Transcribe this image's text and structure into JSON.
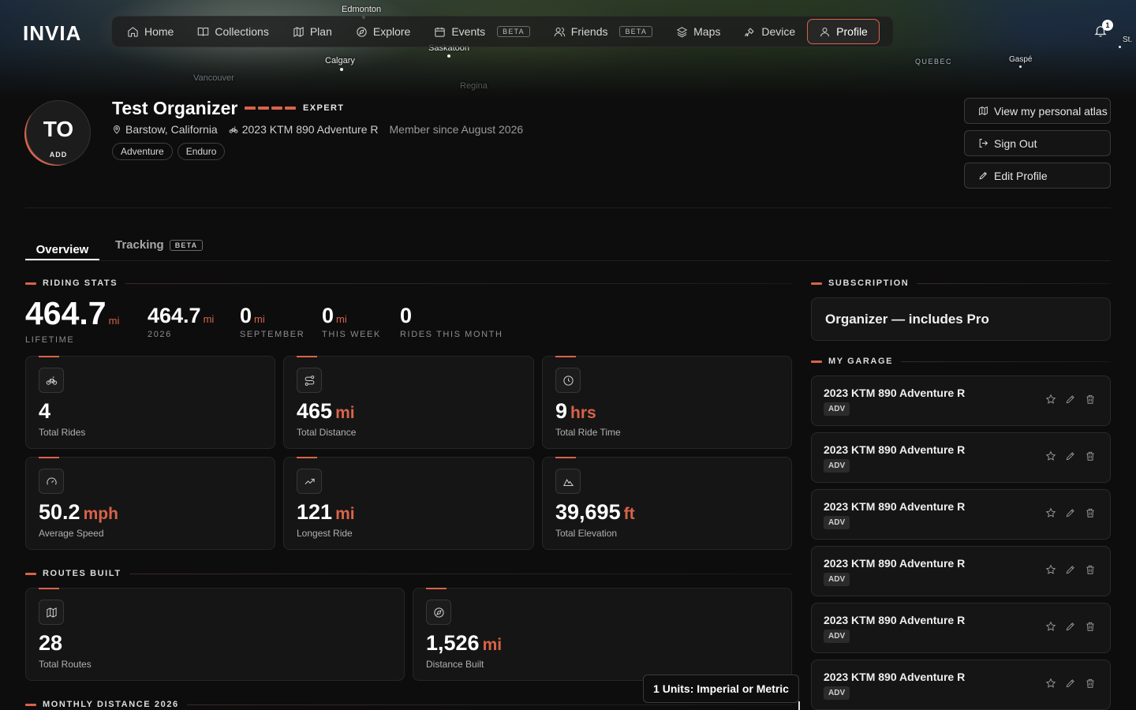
{
  "app": {
    "logo": "INVIA"
  },
  "map_labels": [
    "Edmonton",
    "Saskatoon",
    "Calgary",
    "Vancouver",
    "Regina",
    "QUEBEC",
    "Gaspé",
    "St."
  ],
  "nav": {
    "items": [
      {
        "label": "Home",
        "icon": "home-icon"
      },
      {
        "label": "Collections",
        "icon": "book-icon"
      },
      {
        "label": "Plan",
        "icon": "map-icon"
      },
      {
        "label": "Explore",
        "icon": "compass-icon"
      },
      {
        "label": "Events",
        "icon": "calendar-icon",
        "badge": "BETA"
      },
      {
        "label": "Friends",
        "icon": "users-icon",
        "badge": "BETA"
      },
      {
        "label": "Maps",
        "icon": "layers-icon"
      },
      {
        "label": "Device",
        "icon": "satellite-icon"
      },
      {
        "label": "Profile",
        "icon": "user-icon",
        "active": true
      }
    ],
    "notifications_count": "1"
  },
  "profile": {
    "initials": "TO",
    "avatar_add": "ADD",
    "name": "Test Organizer",
    "level": "EXPERT",
    "location": "Barstow, California",
    "bike": "2023 KTM 890 Adventure R",
    "member_since": "Member since August 2026",
    "tags": [
      "Adventure",
      "Enduro"
    ]
  },
  "actions": {
    "atlas": "View my personal atlas",
    "sign_out": "Sign Out",
    "edit": "Edit Profile"
  },
  "tabs": {
    "overview": "Overview",
    "tracking": "Tracking",
    "tracking_badge": "BETA"
  },
  "riding_stats": {
    "title": "RIDING STATS",
    "lifetime": {
      "value": "464.7",
      "unit": "mi",
      "label": "LIFETIME"
    },
    "year": {
      "value": "464.7",
      "unit": "mi",
      "label": "2026"
    },
    "month": {
      "value": "0",
      "unit": "mi",
      "label": "SEPTEMBER"
    },
    "week": {
      "value": "0",
      "unit": "mi",
      "label": "THIS WEEK"
    },
    "rides_month": {
      "value": "0",
      "label": "RIDES THIS MONTH"
    },
    "cards": [
      {
        "icon": "bike-icon",
        "value": "4",
        "unit": "",
        "label": "Total Rides"
      },
      {
        "icon": "route-icon",
        "value": "465",
        "unit": "mi",
        "label": "Total Distance"
      },
      {
        "icon": "clock-icon",
        "value": "9",
        "unit": "hrs",
        "label": "Total Ride Time"
      },
      {
        "icon": "gauge-icon",
        "value": "50.2",
        "unit": "mph",
        "label": "Average Speed"
      },
      {
        "icon": "trending-up-icon",
        "value": "121",
        "unit": "mi",
        "label": "Longest Ride"
      },
      {
        "icon": "mountain-icon",
        "value": "39,695",
        "unit": "ft",
        "label": "Total Elevation"
      }
    ]
  },
  "routes_built": {
    "title": "ROUTES BUILT",
    "cards": [
      {
        "icon": "map-icon",
        "value": "28",
        "unit": "",
        "label": "Total Routes"
      },
      {
        "icon": "compass-icon",
        "value": "1,526",
        "unit": "mi",
        "label": "Distance Built"
      }
    ]
  },
  "monthly": {
    "title": "MONTHLY DISTANCE 2026"
  },
  "subscription": {
    "title": "SUBSCRIPTION",
    "plan": "Organizer — includes Pro"
  },
  "garage": {
    "title": "MY GARAGE",
    "items": [
      {
        "name": "2023 KTM 890 Adventure R",
        "badge": "ADV"
      },
      {
        "name": "2023 KTM 890 Adventure R",
        "badge": "ADV"
      },
      {
        "name": "2023 KTM 890 Adventure R",
        "badge": "ADV"
      },
      {
        "name": "2023 KTM 890 Adventure R",
        "badge": "ADV"
      },
      {
        "name": "2023 KTM 890 Adventure R",
        "badge": "ADV"
      },
      {
        "name": "2023 KTM 890 Adventure R",
        "badge": "ADV"
      }
    ]
  },
  "toast": {
    "text": "1 Units: Imperial or Metric"
  },
  "colors": {
    "accent": "#d9634a",
    "background": "#0d0d0d",
    "card": "#151515"
  }
}
